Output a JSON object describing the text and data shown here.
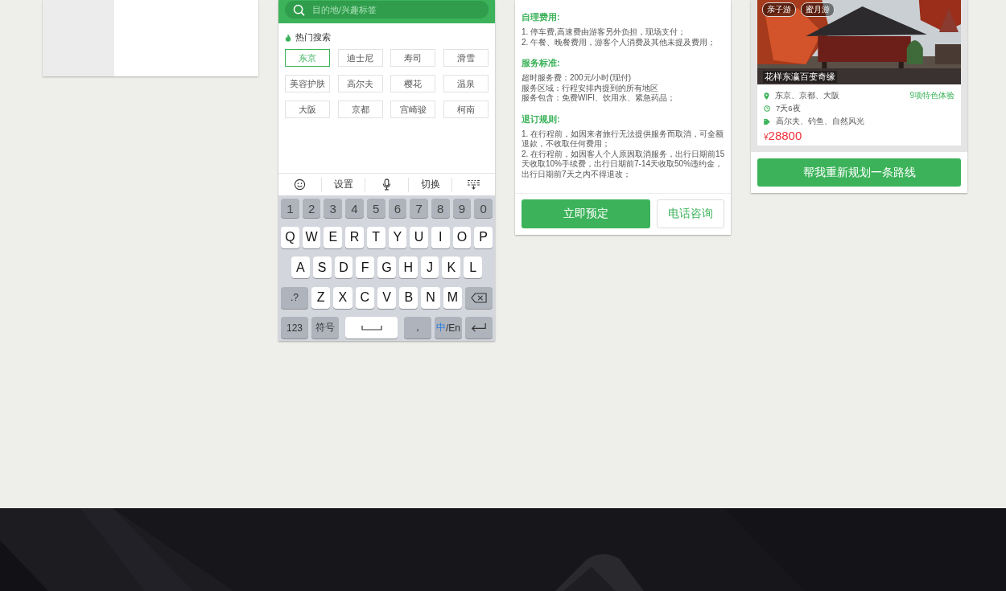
{
  "search_screen": {
    "search": {
      "placeholder": "目的地/兴趣标签"
    },
    "hot_title": "热门搜索",
    "tags": [
      {
        "label": "东京",
        "selected": true
      },
      {
        "label": "迪士尼",
        "selected": false
      },
      {
        "label": "寿司",
        "selected": false
      },
      {
        "label": "滑雪",
        "selected": false
      },
      {
        "label": "美容护肤",
        "selected": false
      },
      {
        "label": "高尔夫",
        "selected": false
      },
      {
        "label": "樱花",
        "selected": false
      },
      {
        "label": "温泉",
        "selected": false
      },
      {
        "label": "大阪",
        "selected": false
      },
      {
        "label": "京都",
        "selected": false
      },
      {
        "label": "宫崎骏",
        "selected": false
      },
      {
        "label": "柯南",
        "selected": false
      }
    ],
    "keyboard_toolbar": [
      {
        "kind": "emoji"
      },
      {
        "kind": "text",
        "label": "设置"
      },
      {
        "kind": "mic"
      },
      {
        "kind": "text",
        "label": "切换"
      },
      {
        "kind": "collapse"
      }
    ],
    "keyboard_rows": [
      [
        {
          "kind": "function",
          "label": "1"
        },
        {
          "kind": "function",
          "label": "2"
        },
        {
          "kind": "function",
          "label": "3"
        },
        {
          "kind": "function",
          "label": "4"
        },
        {
          "kind": "function",
          "label": "5"
        },
        {
          "kind": "function",
          "label": "6"
        },
        {
          "kind": "function",
          "label": "7"
        },
        {
          "kind": "function",
          "label": "8"
        },
        {
          "kind": "function",
          "label": "9"
        },
        {
          "kind": "function",
          "label": "0"
        }
      ],
      [
        {
          "kind": "letter",
          "label": "Q"
        },
        {
          "kind": "letter",
          "label": "W"
        },
        {
          "kind": "letter",
          "label": "E"
        },
        {
          "kind": "letter",
          "label": "R"
        },
        {
          "kind": "letter",
          "label": "T"
        },
        {
          "kind": "letter",
          "label": "Y"
        },
        {
          "kind": "letter",
          "label": "U"
        },
        {
          "kind": "letter",
          "label": "I"
        },
        {
          "kind": "letter",
          "label": "O"
        },
        {
          "kind": "letter",
          "label": "P"
        }
      ],
      [
        {
          "kind": "letter",
          "label": "A"
        },
        {
          "kind": "letter",
          "label": "S"
        },
        {
          "kind": "letter",
          "label": "D"
        },
        {
          "kind": "letter",
          "label": "F"
        },
        {
          "kind": "letter",
          "label": "G"
        },
        {
          "kind": "letter",
          "label": "H"
        },
        {
          "kind": "letter",
          "label": "J"
        },
        {
          "kind": "letter",
          "label": "K"
        },
        {
          "kind": "letter",
          "label": "L"
        }
      ],
      [
        {
          "kind": "function",
          "label": ".?"
        },
        {
          "kind": "letter",
          "label": "Z"
        },
        {
          "kind": "letter",
          "label": "X"
        },
        {
          "kind": "letter",
          "label": "C"
        },
        {
          "kind": "letter",
          "label": "V"
        },
        {
          "kind": "letter",
          "label": "B"
        },
        {
          "kind": "letter",
          "label": "N"
        },
        {
          "kind": "letter",
          "label": "M"
        },
        {
          "kind": "backspace"
        }
      ],
      [
        {
          "kind": "function",
          "label": "123"
        },
        {
          "kind": "function",
          "label": "符号"
        },
        {
          "kind": "space"
        },
        {
          "kind": "function",
          "label": "，"
        },
        {
          "kind": "lang",
          "label": "中",
          "label_2": "/En"
        },
        {
          "kind": "return"
        }
      ]
    ]
  },
  "detail_card": {
    "sections": [
      {
        "heading": "自理费用:",
        "lines": [
          "1. 停车费,高速费由游客另外负担，现场支付；",
          "2. 午餐、晚餐费用，游客个人消费及其他未提及费用；"
        ]
      },
      {
        "heading": "服务标准:",
        "lines": [
          "超时服务费：200元/小时(现付)",
          "服务区域：行程安排内提到的所有地区",
          "服务包含：免费WIFI、饮用水、紧急药品；"
        ]
      },
      {
        "heading": "退订规则:",
        "lines": [
          "1. 在行程前，如因来者旅行无法提供服务而取消，可全额退款，不收取任何费用；",
          "2. 在行程前，如因客人个人原因取消服务，出行日期前15天收取10%手续费，出行日期前7-14天收取50%违约金，出行日期前7天之内不得退改；"
        ]
      }
    ],
    "buttons": [
      {
        "kind": "primary",
        "label": "立即预定"
      },
      {
        "kind": "secondary",
        "label": "电话咨询"
      }
    ]
  },
  "route_card": {
    "tags": [
      "亲子游",
      "蜜月游"
    ],
    "caption": "花样东瀛百变奇缘",
    "places": "东京、京都、大阪",
    "features": "9项特色体验",
    "duration": "7天6夜",
    "themes": "高尔夫、钓鱼、自然风光",
    "price_symbol": "¥",
    "price": "28800",
    "button": "帮我重新规划一条路线"
  }
}
